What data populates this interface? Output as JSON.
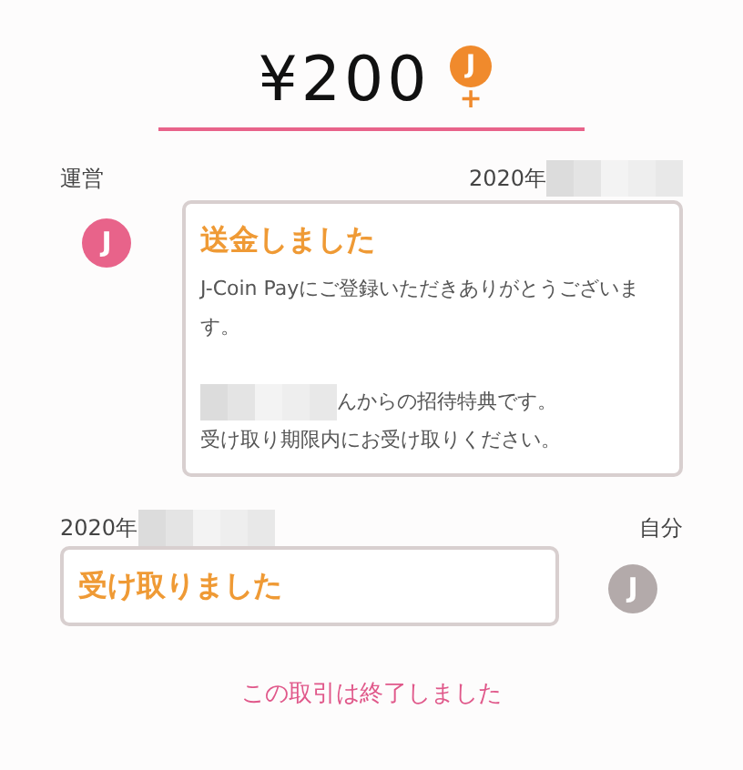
{
  "amount": {
    "text": "¥200",
    "icon_letter": "J",
    "icon_sign": "+"
  },
  "messages": [
    {
      "kind": "incoming",
      "sender": "運営",
      "date": "2020年",
      "date_redacted": true,
      "avatar_letter": "J",
      "title": "送金しました",
      "paragraphs": [
        [
          {
            "text": "J-Coin Payにご登録いただきありがとうございます。",
            "redacted": false
          }
        ],
        [
          {
            "text": "んからの招待特典です。",
            "redacted": true
          },
          {
            "text": "受け取り期限内にお受け取りください。",
            "redacted": false
          }
        ]
      ]
    },
    {
      "kind": "outgoing",
      "sender": "自分",
      "date": "2020年",
      "date_redacted": true,
      "avatar_letter": "J",
      "title": "受け取りました"
    }
  ],
  "footer": "この取引は終了しました"
}
